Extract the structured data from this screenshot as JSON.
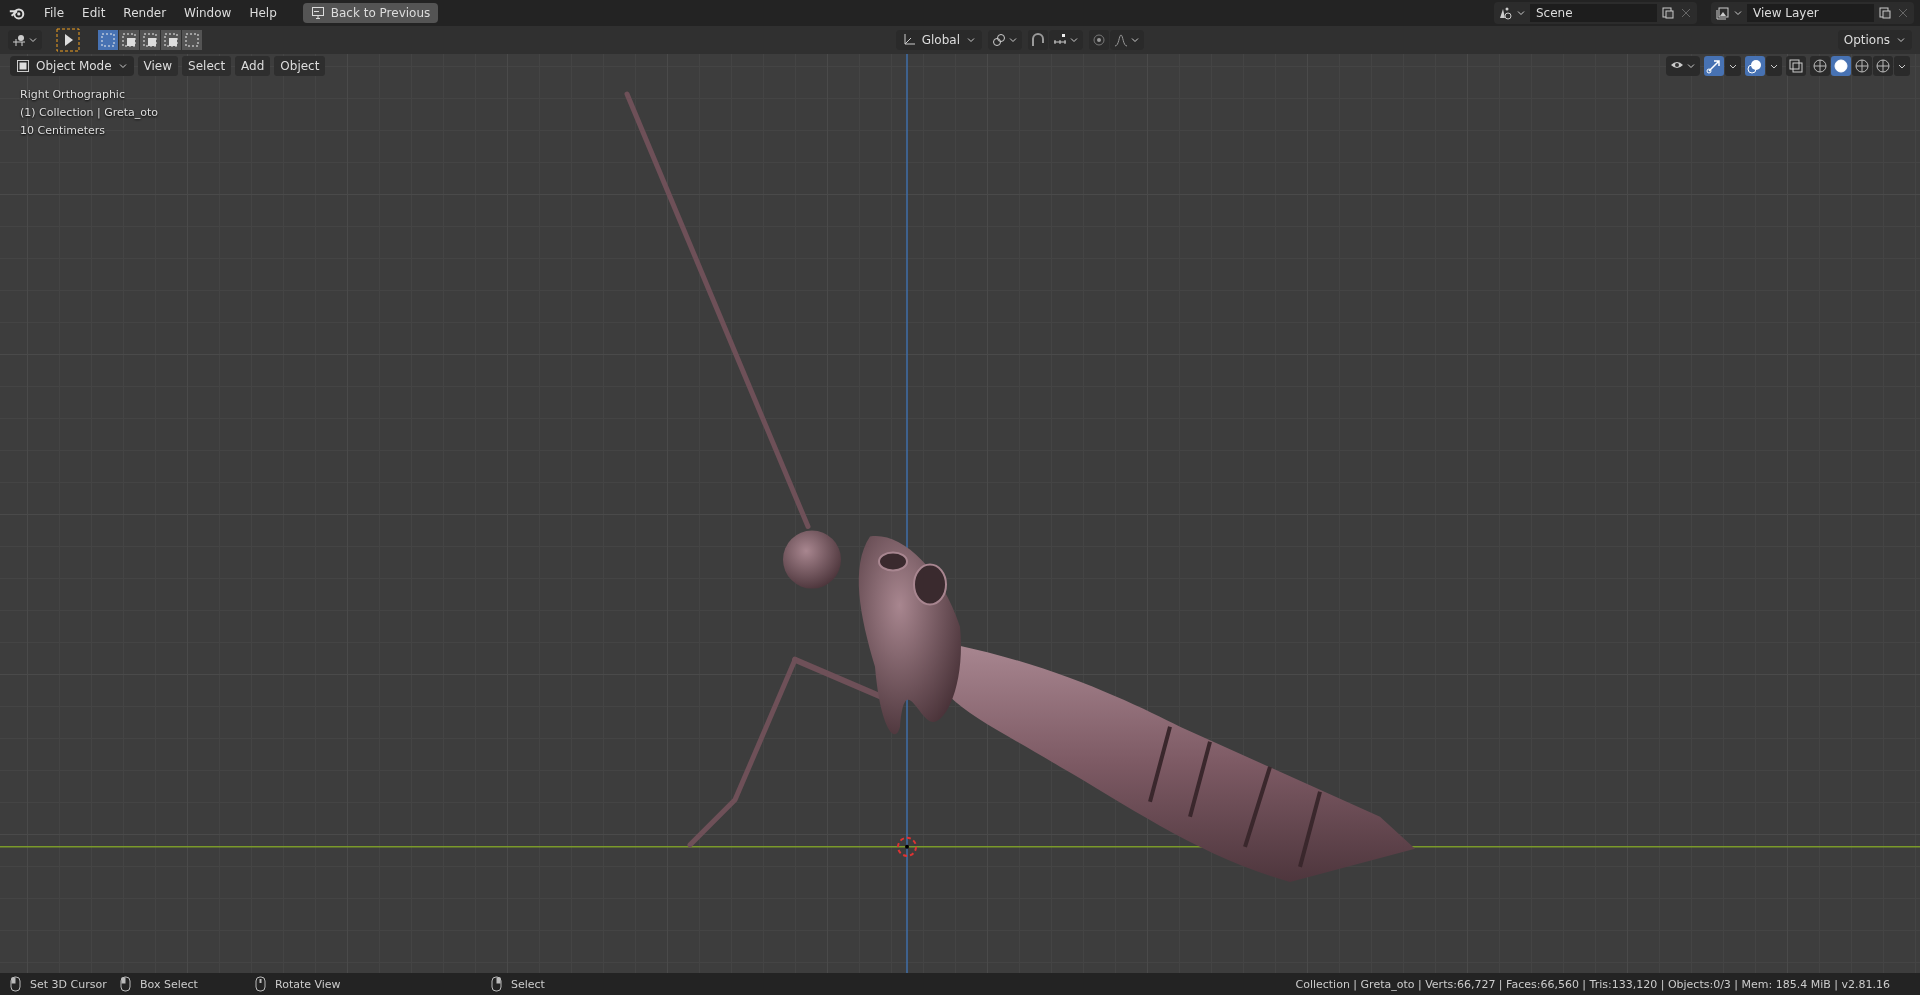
{
  "top_bar": {
    "menus": [
      "File",
      "Edit",
      "Render",
      "Window",
      "Help"
    ],
    "back_button": "Back to Previous",
    "scene": {
      "value": "Scene"
    },
    "view_layer": {
      "value": "View Layer"
    }
  },
  "tool_header": {
    "select_modes": [
      {
        "selected": true
      },
      {
        "selected": false
      },
      {
        "selected": false
      },
      {
        "selected": false
      },
      {
        "selected": false
      }
    ],
    "orientation": "Global",
    "snap_on": false,
    "proportional_on": false,
    "options": "Options"
  },
  "viewport_header": {
    "mode": "Object Mode",
    "menus": [
      "View",
      "Select",
      "Add",
      "Object"
    ],
    "gizmo_on": true,
    "overlays_on": true,
    "xray_on": false,
    "shading": [
      {
        "selected": false
      },
      {
        "selected": true
      },
      {
        "selected": false
      },
      {
        "selected": false
      }
    ]
  },
  "viewport_info": [
    "Right Orthographic",
    "(1) Collection | Greta_oto",
    "10 Centimeters"
  ],
  "status_bar": {
    "hints": [
      {
        "kind": "left",
        "label": "Set 3D Cursor"
      },
      {
        "kind": "drag",
        "label": "Box Select"
      },
      {
        "kind": "middle",
        "label": "Rotate View"
      },
      {
        "kind": "right",
        "label": "Select"
      }
    ],
    "stats": "Collection | Greta_oto | Verts:66,727 | Faces:66,560 | Tris:133,120 | Objects:0/3 | Mem: 185.4 MiB | v2.81.16"
  }
}
